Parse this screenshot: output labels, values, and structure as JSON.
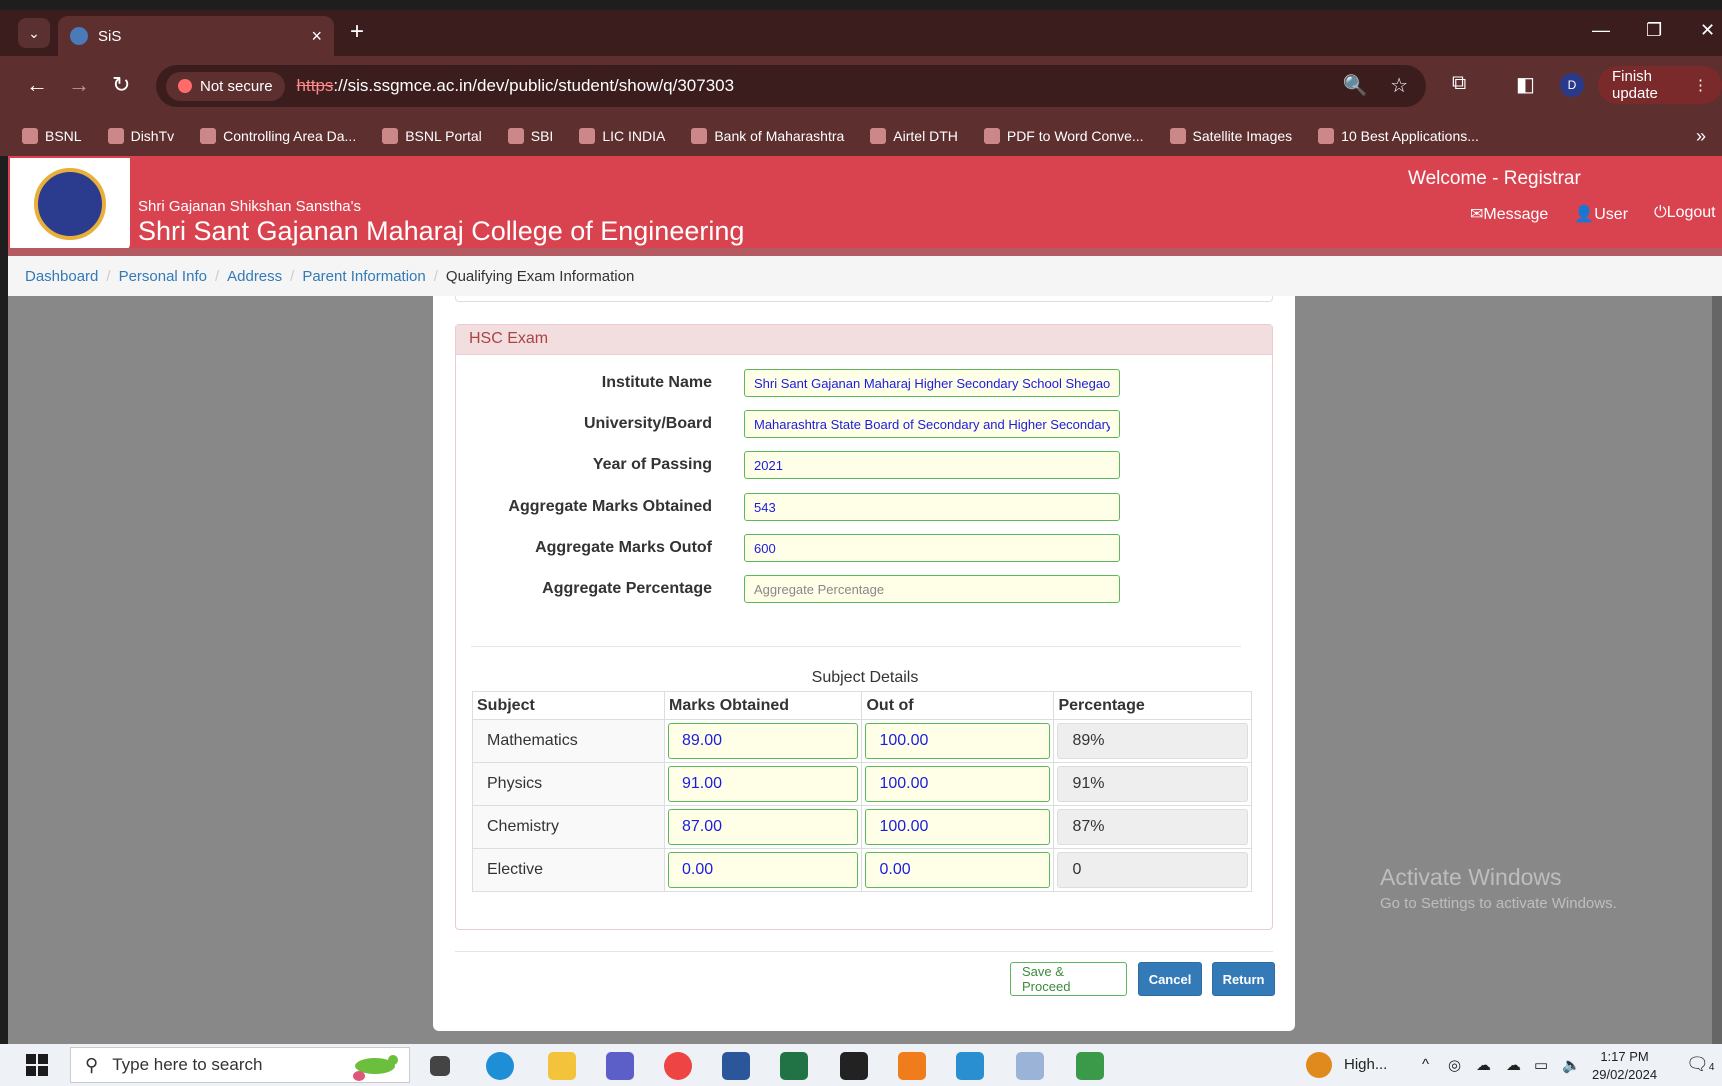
{
  "browser": {
    "tab_title": "SiS",
    "not_secure": "Not secure",
    "url_scheme": "https",
    "url_rest": "://sis.ssgmce.ac.in/dev/public/student/show/q/307303",
    "profile_initial": "D",
    "finish_update": "Finish update",
    "bookmarks": [
      "BSNL",
      "DishTv",
      "Controlling Area Da...",
      "BSNL Portal",
      "SBI",
      "LIC INDIA",
      "Bank of Maharashtra",
      "Airtel DTH",
      "PDF to Word Conve...",
      "Satellite Images",
      "10 Best Applications..."
    ]
  },
  "header": {
    "sanstha": "Shri Gajanan Shikshan Sanstha's",
    "college": "Shri Sant Gajanan Maharaj College of Engineering",
    "welcome": "Welcome - Registrar",
    "message": "Message",
    "user": "User",
    "logout": "Logout"
  },
  "breadcrumb": {
    "items": [
      "Dashboard",
      "Personal Info",
      "Address",
      "Parent Information"
    ],
    "active": "Qualifying Exam Information"
  },
  "hsc": {
    "heading": "HSC Exam",
    "fields": [
      {
        "label": "Institute Name",
        "value": "Shri Sant Gajanan Maharaj Higher Secondary School Shegao",
        "placeholder": ""
      },
      {
        "label": "University/Board",
        "value": "Maharashtra State Board of Secondary and Higher Secondary",
        "placeholder": ""
      },
      {
        "label": "Year of Passing",
        "value": "2021",
        "placeholder": ""
      },
      {
        "label": "Aggregate Marks Obtained",
        "value": "543",
        "placeholder": ""
      },
      {
        "label": "Aggregate Marks Outof",
        "value": "600",
        "placeholder": ""
      },
      {
        "label": "Aggregate Percentage",
        "value": "",
        "placeholder": "Aggregate Percentage"
      }
    ],
    "subject_title": "Subject Details",
    "columns": [
      "Subject",
      "Marks Obtained",
      "Out of",
      "Percentage"
    ],
    "rows": [
      {
        "subject": "Mathematics",
        "obtained": "89.00",
        "outof": "100.00",
        "percentage": "89%"
      },
      {
        "subject": "Physics",
        "obtained": "91.00",
        "outof": "100.00",
        "percentage": "91%"
      },
      {
        "subject": "Chemistry",
        "obtained": "87.00",
        "outof": "100.00",
        "percentage": "87%"
      },
      {
        "subject": "Elective",
        "obtained": "0.00",
        "outof": "0.00",
        "percentage": "0"
      }
    ]
  },
  "actions": {
    "save": "Save & Proceed",
    "cancel": "Cancel",
    "return": "Return"
  },
  "watermark": {
    "line1": "Activate Windows",
    "line2": "Go to Settings to activate Windows."
  },
  "taskbar": {
    "search_placeholder": "Type here to search",
    "weather": "High...",
    "time": "1:17 PM",
    "date": "29/02/2024",
    "notif_count": "4"
  }
}
